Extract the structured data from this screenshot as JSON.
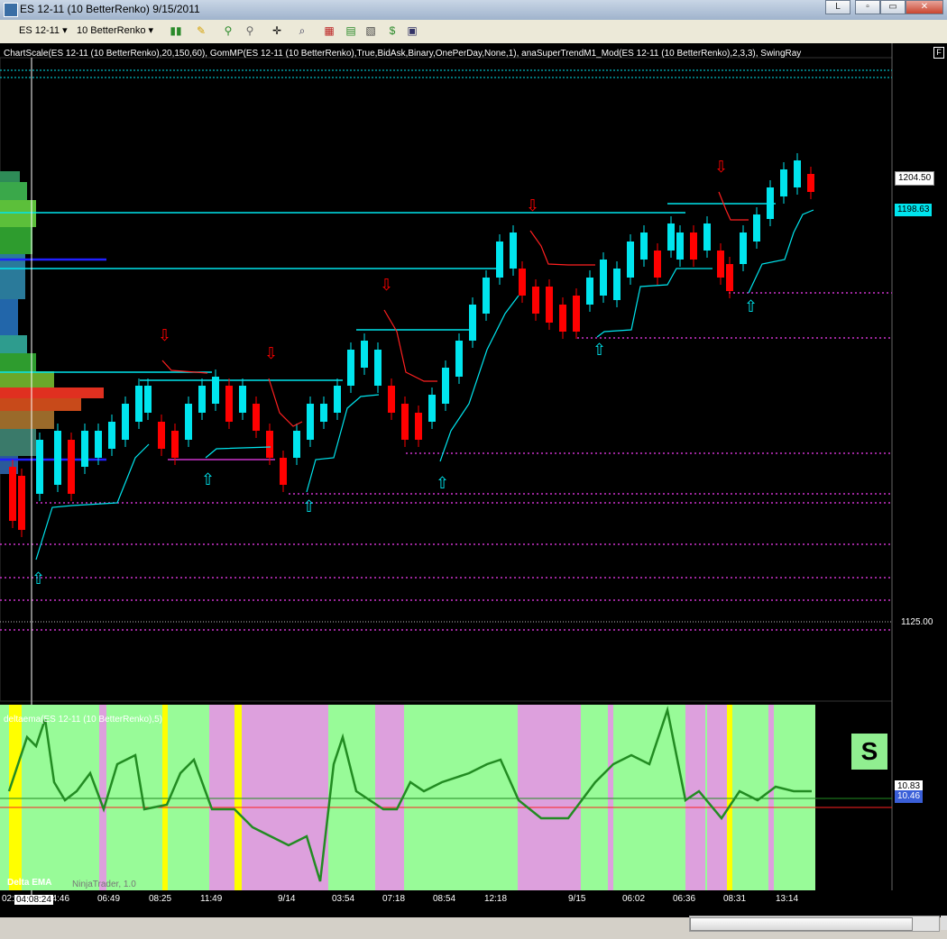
{
  "window": {
    "title": "ES 12-11 (10 BetterRenko)  9/15/2011",
    "buttons": [
      "L",
      "▫",
      "▭",
      "✕"
    ]
  },
  "toolbar": {
    "instrument": "ES 12-11",
    "period": "10 BetterRenko",
    "icons": [
      "candlestick-icon",
      "pencil-icon",
      "pin-icon",
      "crosshair-icon",
      "zoom-icon",
      "bar-chart-icon",
      "indicator-icon",
      "dollar-icon",
      "properties-icon"
    ]
  },
  "chart": {
    "indicator_text": "ChartScale(ES 12-11 (10 BetterRenko),20,150,60), GomMP(ES 12-11 (10 BetterRenko),True,BidAsk,Binary,OnePerDay,None,1), anaSuperTrendM1_Mod(ES 12-11 (10 BetterRenko),2,3,3), SwingRay",
    "f_badge": "F",
    "price_labels": {
      "last": "1204.50",
      "trend": "1198.63",
      "axis": "1125.00"
    },
    "colors": {
      "up": "#00e5ee",
      "down": "#ff0000",
      "swing": "#cc33cc",
      "profile_green": "#2e9c2e",
      "profile_red": "#e03020"
    }
  },
  "indicator_panel": {
    "title": "deltaema(ES 12-11 (10 BetterRenko),5)",
    "title2": "Delta EMA",
    "brand": "NinjaTrader, 1.0",
    "values": {
      "ema": "10.83",
      "signal": "10.46"
    },
    "signal_badge": "S",
    "colors": {
      "green_band": "#98fb98",
      "pink_band": "#dda0dd",
      "yellow_band": "#ffff00",
      "line_up": "#228b22",
      "line_down": "#ff0000"
    }
  },
  "time_axis": {
    "cursor_time": "04:08:24",
    "ticks": [
      "02:",
      "24:46",
      "06:49",
      "08:25",
      "11:49",
      "9/14",
      "03:54",
      "07:18",
      "08:54",
      "12:18",
      "9/15",
      "06:02",
      "06:36",
      "08:31",
      "13:14"
    ]
  }
}
